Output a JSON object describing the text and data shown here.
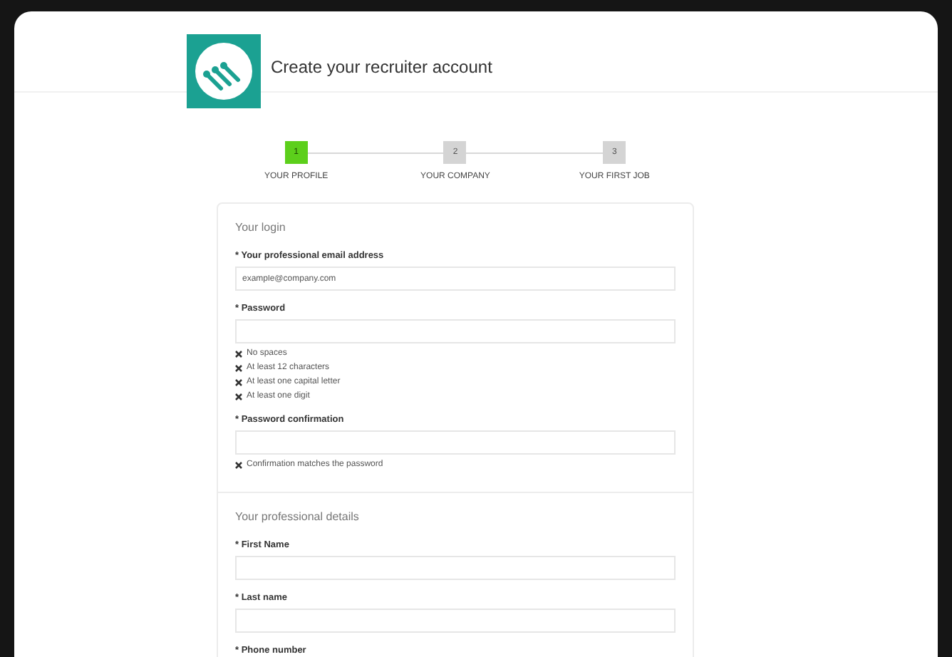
{
  "header": {
    "title": "Create your recruiter account"
  },
  "steps": [
    {
      "number": "1",
      "label": "YOUR PROFILE",
      "selected": true
    },
    {
      "number": "2",
      "label": "YOUR COMPANY",
      "selected": false
    },
    {
      "number": "3",
      "label": "YOUR FIRST JOB",
      "selected": false
    }
  ],
  "sections": [
    {
      "title": "Your login",
      "fields": [
        {
          "kind": "input",
          "label": "* Your professional email address",
          "value": "example@company.com"
        },
        {
          "kind": "input",
          "label": "* Password",
          "rules": [
            {
              "text": "No spaces",
              "met": false
            },
            {
              "text": "At least 12 characters",
              "met": false
            },
            {
              "text": "At least one capital letter",
              "met": false
            },
            {
              "text": "At least one digit",
              "met": false
            }
          ]
        },
        {
          "kind": "input",
          "label": "* Password confirmation",
          "rules": [
            {
              "text": "Confirmation matches the password",
              "met": false
            }
          ]
        }
      ]
    },
    {
      "title": "Your professional details",
      "fields": [
        {
          "kind": "input",
          "label": "* First Name"
        },
        {
          "kind": "input",
          "label": "* Last name"
        },
        {
          "kind": "label",
          "label": "* Phone number"
        }
      ]
    }
  ]
}
